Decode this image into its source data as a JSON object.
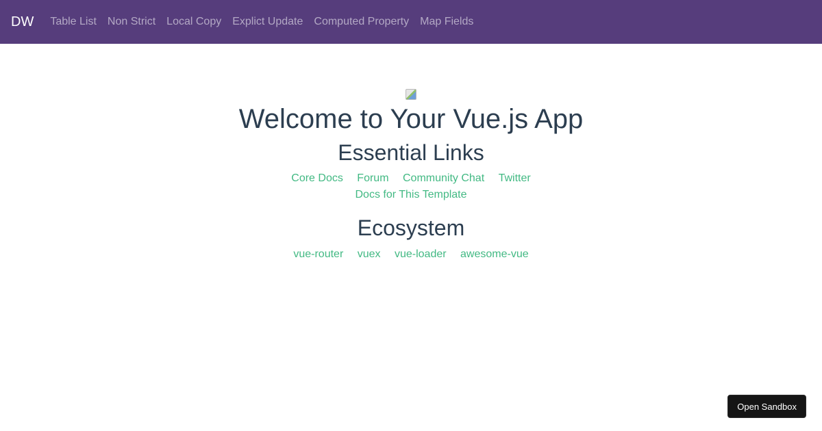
{
  "navbar": {
    "brand": "DW",
    "links": [
      "Table List",
      "Non Strict",
      "Local Copy",
      "Explict Update",
      "Computed Property",
      "Map Fields"
    ],
    "background": "#563d7c"
  },
  "main": {
    "logo_icon": "broken-image-icon",
    "title": "Welcome to Your Vue.js App",
    "essential_heading": "Essential Links",
    "essential_links": [
      "Core Docs",
      "Forum",
      "Community Chat",
      "Twitter",
      "Docs for This Template"
    ],
    "ecosystem_heading": "Ecosystem",
    "ecosystem_links": [
      "vue-router",
      "vuex",
      "vue-loader",
      "awesome-vue"
    ],
    "text_color": "#2c3e50",
    "link_color": "#42b983"
  },
  "sandbox": {
    "label": "Open Sandbox"
  }
}
